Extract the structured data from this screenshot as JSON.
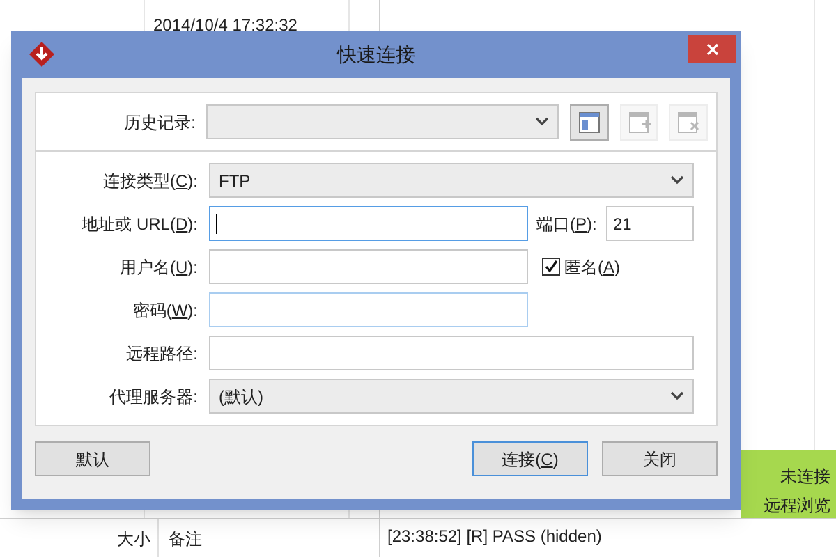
{
  "background": {
    "timestamp": "2014/10/4 17:32:32",
    "status": "未连接",
    "status_sub": "远程浏览",
    "columns": [
      "大小",
      "备注"
    ],
    "log": [
      "[23:38:52] [R] PASS (hidden)"
    ]
  },
  "dialog": {
    "title": "快速连接",
    "history": {
      "label": "历史记录:"
    },
    "tools": [
      {
        "disabled": false
      },
      {
        "disabled": true
      },
      {
        "disabled": true
      }
    ],
    "fields": [
      {
        "kind": "combo",
        "pre": "连接类型(",
        "key": "C",
        "post": "):",
        "value": "FTP"
      },
      {
        "kind": "text",
        "pre": "地址或 URL(",
        "key": "D",
        "post": "):",
        "focused": true,
        "side": {
          "kind": "port",
          "pre": "端口(",
          "key": "P",
          "post": "):",
          "value": "21"
        }
      },
      {
        "kind": "text",
        "pre": "用户名(",
        "key": "U",
        "post": "):",
        "focused": false,
        "side": {
          "kind": "checkbox",
          "pre": "匿名(",
          "key": "A",
          "post": ")",
          "checked": true
        }
      },
      {
        "kind": "text",
        "pre": "密码(",
        "key": "W",
        "post": "):",
        "focused": false,
        "highlight": true
      },
      {
        "kind": "wide",
        "pre": "远程路径:"
      },
      {
        "kind": "combo",
        "pre": "代理服务器:",
        "value": "(默认)"
      }
    ],
    "buttons": [
      {
        "pre": "默认",
        "default": false
      },
      {
        "pre": "连接(",
        "key": "C",
        "post": ")",
        "default": true
      },
      {
        "pre": "关闭",
        "default": false
      }
    ]
  }
}
